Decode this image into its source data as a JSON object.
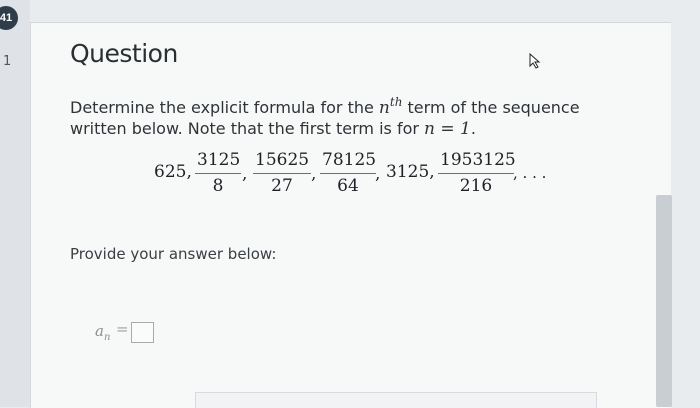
{
  "badge": "41",
  "rail_mark": "1",
  "question": {
    "title": "Question",
    "prompt_part1": "Determine the explicit formula for the ",
    "prompt_var": "n",
    "prompt_sup": "th",
    "prompt_part2": " term of the sequence written below. Note that the first term is for ",
    "prompt_eq": "n = 1",
    "prompt_end": "."
  },
  "sequence": {
    "t1": "625,",
    "f2_num": "3125",
    "f2_den": "8",
    "c2": ",",
    "f3_num": "15625",
    "f3_den": "27",
    "c3": ",",
    "f4_num": "78125",
    "f4_den": "64",
    "c4": ",",
    "t5": "3125,",
    "f6_num": "1953125",
    "f6_den": "216",
    "tail": ", . . ."
  },
  "answer": {
    "provide_label": "Provide your answer below:",
    "var": "a",
    "sub": "n",
    "eq": "="
  }
}
